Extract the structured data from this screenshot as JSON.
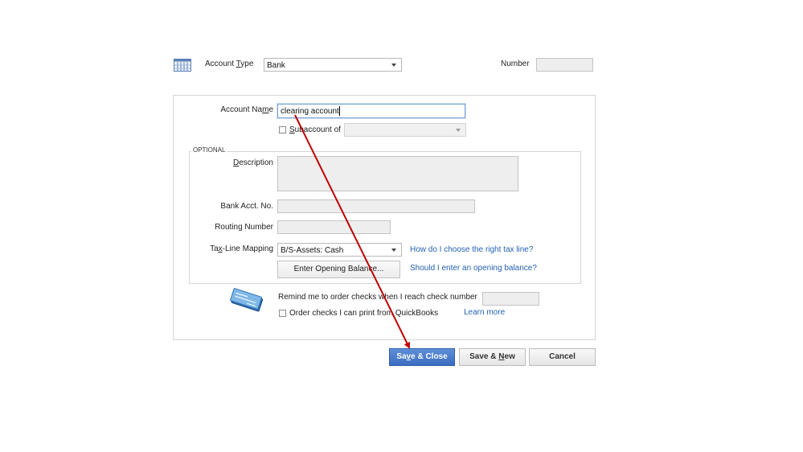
{
  "header": {
    "account_type_label_pre": "Account ",
    "account_type_label_u": "T",
    "account_type_label_post": "ype",
    "account_type_value": "Bank",
    "number_label": "Number",
    "number_value": ""
  },
  "form": {
    "account_name_label_pre": "Account Na",
    "account_name_label_u": "m",
    "account_name_label_post": "e",
    "account_name_value": "clearing account",
    "subaccount_label_u": "S",
    "subaccount_label_post": "ubaccount of",
    "subaccount_value": ""
  },
  "optional": {
    "section_label": "OPTIONAL",
    "description_label_u": "D",
    "description_label_post": "escription",
    "description_value": "",
    "bank_acct_label": "Bank Acct. No.",
    "bank_acct_value": "",
    "routing_label": "Routing Number",
    "routing_value": "",
    "tax_line_label_pre": "Ta",
    "tax_line_label_u": "x",
    "tax_line_label_post": "-Line Mapping",
    "tax_line_value": "B/S-Assets: Cash",
    "tax_line_help_link": "How do I choose the right tax line?",
    "opening_balance_button": "Enter Opening Balance...",
    "opening_balance_help_link": "Should I enter an opening balance?"
  },
  "checks": {
    "remind_label": "Remind me to order checks when I reach check number",
    "remind_value": "",
    "order_checks_label": "Order checks I can print from QuickBooks",
    "learn_more_link": "Learn more"
  },
  "buttons": {
    "save_close_pre": "Sa",
    "save_close_u": "v",
    "save_close_post": "e & Close",
    "save_new_pre": "Save & ",
    "save_new_u": "N",
    "save_new_post": "ew",
    "cancel": "Cancel"
  },
  "annotation": {
    "arrow_color": "#c00000"
  }
}
